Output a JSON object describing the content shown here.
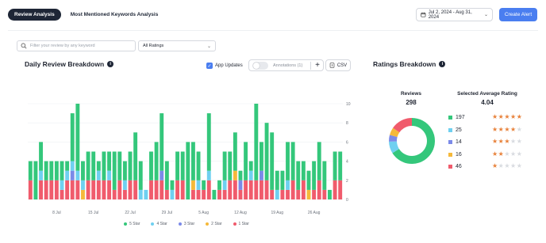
{
  "tabs": [
    {
      "label": "Review Analysis",
      "active": true
    },
    {
      "label": "Most Mentioned Keywords Analysis",
      "active": false
    }
  ],
  "date_range": "Jul 2, 2024 - Aug 31, 2024",
  "create_alert": "Create Alert",
  "search": {
    "placeholder": "Filter your review by any keyword"
  },
  "ratings_filter": "All Ratings",
  "daily": {
    "title": "Daily Review Breakdown",
    "app_updates": "App Updates",
    "annotations": "Annotations (1)",
    "csv": "CSV"
  },
  "breakdown": {
    "title": "Ratings Breakdown",
    "reviews_label": "Reviews",
    "reviews_value": "298",
    "avg_label": "Selected Average Rating",
    "avg_value": "4.04",
    "rows": [
      {
        "count": "197",
        "stars": 5,
        "color": "#34c77b"
      },
      {
        "count": "25",
        "stars": 4,
        "color": "#6fd0f0"
      },
      {
        "count": "14",
        "stars": 3,
        "color": "#7b8ae8"
      },
      {
        "count": "16",
        "stars": 2,
        "color": "#f5b93a"
      },
      {
        "count": "46",
        "stars": 1,
        "color": "#f05b6c"
      }
    ]
  },
  "colors": {
    "accent": "#4a7ef0",
    "dark": "#1e2636",
    "star": "#e8823b"
  },
  "chart_data": [
    {
      "type": "bar",
      "stacked": true,
      "x_tick_labels": [
        "8 Jul",
        "15 Jul",
        "22 Jul",
        "29 Jul",
        "5 Aug",
        "12 Aug",
        "19 Aug",
        "26 Aug"
      ],
      "ylim": [
        0,
        10
      ],
      "yticks": [
        0,
        2,
        4,
        6,
        8,
        10
      ],
      "legend_position": "bottom",
      "series": [
        {
          "name": "5 Star",
          "color": "#34c77b",
          "values": [
            2,
            4,
            3,
            2,
            2,
            2,
            2,
            1,
            5,
            7,
            2,
            3,
            3,
            1,
            3,
            2,
            4,
            3,
            2,
            3,
            5,
            3,
            0,
            3,
            4,
            6,
            3,
            1,
            3,
            3,
            6,
            4,
            3,
            1,
            6,
            1,
            1,
            3,
            3,
            4,
            1,
            4,
            1,
            8,
            3,
            6,
            6,
            2,
            2,
            4,
            4,
            3,
            2,
            2,
            3,
            4,
            3,
            1,
            3,
            3
          ]
        },
        {
          "name": "4 Star",
          "color": "#6fd0f0",
          "values": [
            0,
            0,
            1,
            0,
            0,
            0,
            1,
            1,
            1,
            1,
            1,
            0,
            0,
            1,
            0,
            1,
            0,
            0,
            1,
            0,
            0,
            1,
            1,
            0,
            0,
            0,
            0,
            1,
            0,
            0,
            0,
            0,
            1,
            0,
            1,
            0,
            0,
            1,
            0,
            0,
            0,
            0,
            1,
            0,
            0,
            0,
            0,
            1,
            0,
            1,
            0,
            0,
            0,
            0,
            0,
            0,
            0,
            0,
            0,
            0
          ]
        },
        {
          "name": "3 Star",
          "color": "#7b8ae8",
          "values": [
            0,
            0,
            0,
            0,
            0,
            0,
            0,
            0,
            1,
            0,
            0,
            0,
            0,
            0,
            0,
            0,
            0,
            0,
            0,
            0,
            0,
            0,
            0,
            0,
            0,
            1,
            0,
            0,
            0,
            0,
            0,
            0,
            0,
            0,
            0,
            0,
            0,
            0,
            0,
            0,
            1,
            0,
            0,
            0,
            1,
            0,
            0,
            0,
            0,
            0,
            0,
            0,
            0,
            0,
            0,
            0,
            0,
            0,
            0,
            0
          ]
        },
        {
          "name": "2 Star",
          "color": "#f5b93a",
          "values": [
            0,
            0,
            0,
            0,
            0,
            0,
            0,
            0,
            0,
            0,
            1,
            0,
            0,
            0,
            0,
            0,
            0,
            0,
            0,
            0,
            0,
            0,
            0,
            0,
            0,
            0,
            0,
            0,
            0,
            0,
            0,
            1,
            0,
            0,
            0,
            0,
            0,
            0,
            0,
            1,
            0,
            0,
            0,
            0,
            0,
            0,
            0,
            0,
            0,
            0,
            0,
            0,
            0,
            1,
            0,
            0,
            0,
            0,
            0,
            0
          ]
        },
        {
          "name": "1 Star",
          "color": "#f05b6c",
          "values": [
            2,
            0,
            2,
            2,
            2,
            2,
            1,
            2,
            2,
            2,
            0,
            2,
            2,
            2,
            2,
            2,
            1,
            2,
            1,
            2,
            2,
            0,
            0,
            2,
            2,
            2,
            1,
            0,
            2,
            2,
            0,
            1,
            1,
            1,
            2,
            0,
            1,
            1,
            2,
            2,
            1,
            2,
            2,
            2,
            2,
            2,
            1,
            0,
            1,
            1,
            2,
            1,
            2,
            0,
            1,
            2,
            1,
            0,
            2,
            2
          ]
        }
      ]
    },
    {
      "type": "pie",
      "donut": true,
      "labels": [
        "5 Star",
        "4 Star",
        "3 Star",
        "2 Star",
        "1 Star"
      ],
      "values": [
        197,
        25,
        14,
        16,
        46
      ],
      "colors": [
        "#34c77b",
        "#6fd0f0",
        "#7b8ae8",
        "#f5b93a",
        "#f05b6c"
      ]
    }
  ]
}
